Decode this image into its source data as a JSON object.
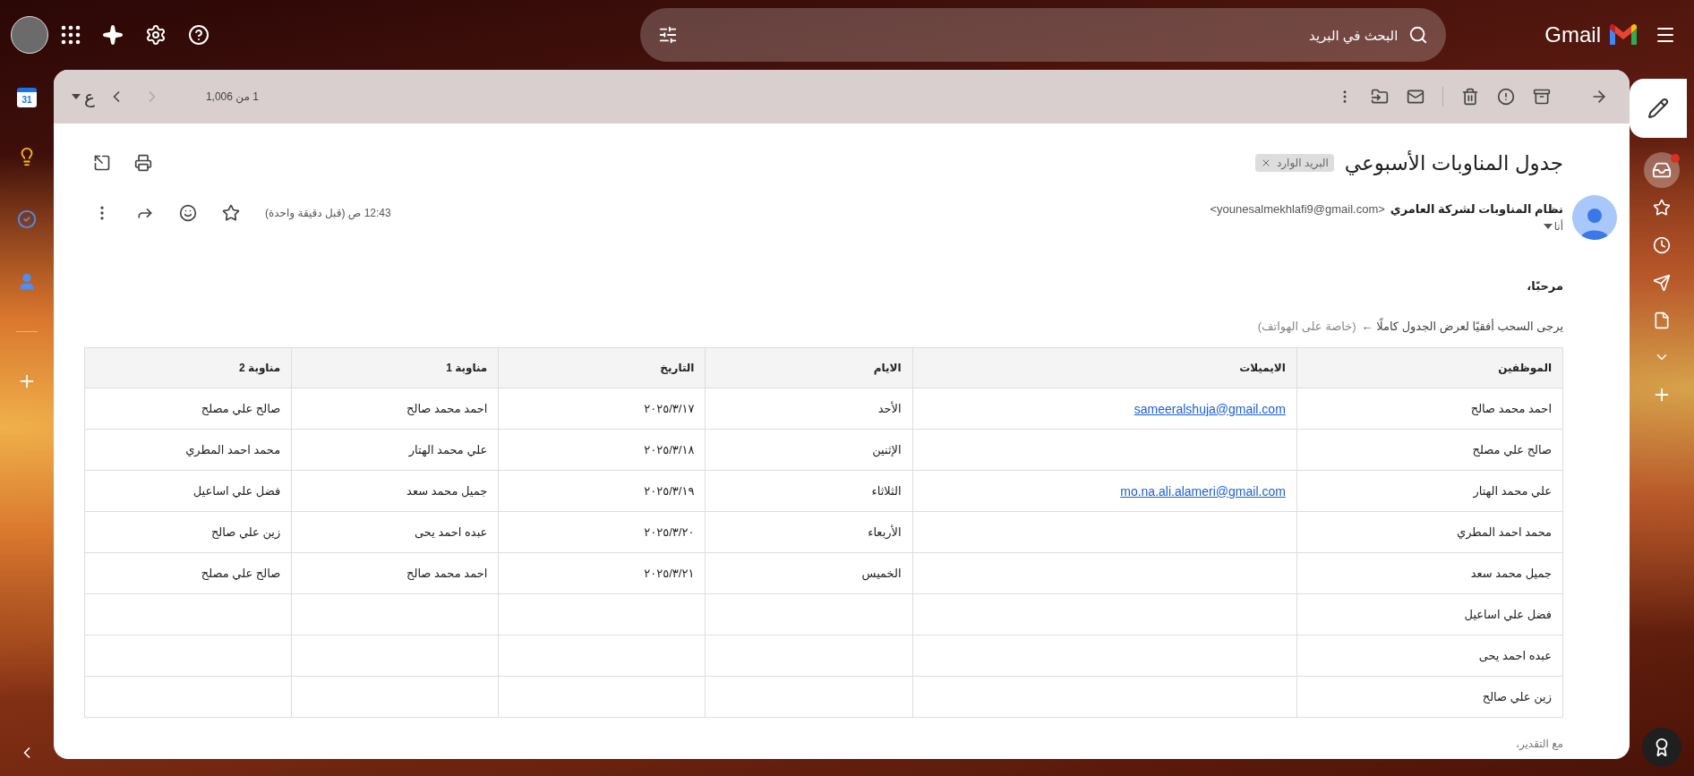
{
  "top_bar": {
    "logo_text": "Gmail",
    "search": {
      "placeholder": "البحث في البريد"
    }
  },
  "left_rail": {
    "calendar_day": "31"
  },
  "toolbar": {
    "count": "1 من 1,006",
    "input_tool": "ع",
    "newer_button": {
      "disabled": true
    },
    "older_button": {
      "disabled": false
    }
  },
  "email": {
    "subject": "جدول المناوبات الأسبوعي",
    "label": "البريد الوارد",
    "sender_name": "نظام المناوبات لشركة العامري",
    "sender_email": "<younesalmekhlafi9@gmail.com>",
    "recipient": "أنا",
    "time": "12:43 ص (قبل دقيقة واحدة)",
    "starred": false,
    "greeting": "مرحبًا،",
    "instruction": "يرجى السحب أفقيًا لعرض الجدول كاملًا ←",
    "hint": "(خاصة على الهواتف)",
    "table": {
      "columns": [
        "الموظفين",
        "الايميلات",
        "الايام",
        "التاريخ",
        "مناوبة 1",
        "مناوبة 2"
      ],
      "rows": [
        {
          "employee": "احمد محمد صالح",
          "email": "sameeralshuja@gmail.com",
          "day": "الأحد",
          "date": "٢٠٢٥/٣/١٧",
          "shift_1": "احمد محمد صالح",
          "shift_2": "صالح علي مصلح"
        },
        {
          "employee": "صالح علي مصلح",
          "day": "الإثنين",
          "date": "٢٠٢٥/٣/١٨",
          "shift_1": "علي محمد الهتار",
          "shift_2": "محمد احمد المطري"
        },
        {
          "employee": "علي محمد الهتار",
          "email": "mo.na.ali.alameri@gmail.com",
          "day": "الثلاثاء",
          "date": "٢٠٢٥/٣/١٩",
          "shift_1": "جميل محمد سعد",
          "shift_2": "فضل علي اساعيل"
        },
        {
          "employee": "محمد احمد المطري",
          "day": "الأربعاء",
          "date": "٢٠٢٥/٣/٢٠",
          "shift_1": "عبده احمد يحى",
          "shift_2": "زين علي صالح"
        },
        {
          "employee": "جميل محمد سعد",
          "day": "الخميس",
          "date": "٢٠٢٥/٣/٢١",
          "shift_1": "احمد محمد صالح",
          "shift_2": "صالح علي مصلح"
        },
        {
          "employee": "فضل علي اساعيل"
        },
        {
          "employee": "عبده احمد يحى"
        },
        {
          "employee": "زين علي صالح"
        }
      ]
    },
    "closing": "مع التقدير،"
  }
}
